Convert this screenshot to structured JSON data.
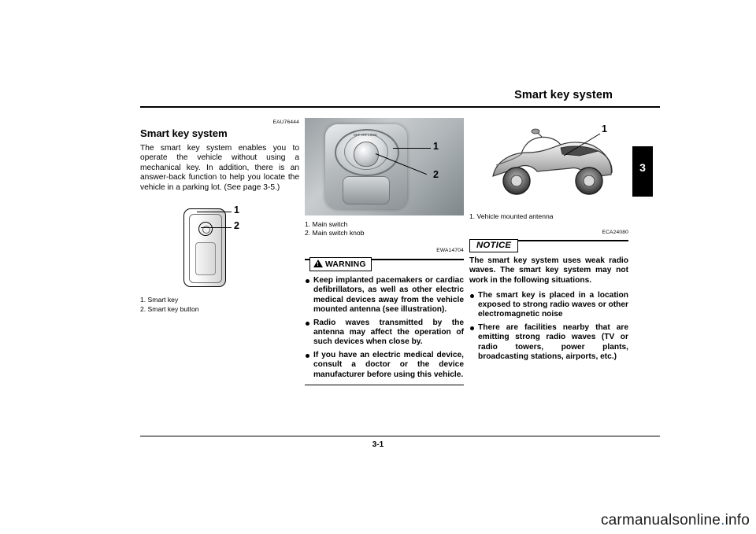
{
  "header": {
    "title": "Smart key system"
  },
  "chapter": {
    "number": "3"
  },
  "footer": {
    "page_number": "3-1",
    "watermark": "carmanualsonline.info"
  },
  "column1": {
    "code": "EAU76444",
    "heading": "Smart key system",
    "paragraph": "The smart key system enables you to operate the vehicle without using a mechanical key. In addition, there is an answer-back function to help you locate the vehicle in a parking lot. (See page 3-5.)",
    "figure": {
      "name": "smart-key-figure",
      "callouts": [
        "1",
        "2"
      ]
    },
    "caption_lines": [
      "1. Smart key",
      "2. Smart key button"
    ]
  },
  "column2": {
    "figure": {
      "name": "main-switch-figure",
      "callouts": [
        "1",
        "2"
      ],
      "dial_text": "OFF ON LOCK"
    },
    "caption_lines": [
      "1. Main switch",
      "2. Main switch knob"
    ],
    "code": "EWA14704",
    "warning_label": "WARNING",
    "warning_bullets": [
      "Keep implanted pacemakers or cardiac defibrillators, as well as other electric medical devices away from the vehicle mounted antenna (see illustration).",
      "Radio waves transmitted by the antenna may affect the operation of such devices when close by.",
      "If you have an electric medical device, consult a doctor or the device manufacturer before using this vehicle."
    ]
  },
  "column3": {
    "figure": {
      "name": "vehicle-antenna-figure",
      "callouts": [
        "1"
      ]
    },
    "caption_lines": [
      "1. Vehicle mounted antenna"
    ],
    "code": "ECA24080",
    "notice_label": "NOTICE",
    "notice_intro": "The smart key system uses weak radio waves. The smart key system may not work in the following situations.",
    "notice_bullets": [
      "The smart key is placed in a location exposed to strong radio waves or other electromagnetic noise",
      "There are facilities nearby that are emitting strong radio waves (TV or radio towers, power plants, broadcasting stations, airports, etc.)"
    ]
  }
}
